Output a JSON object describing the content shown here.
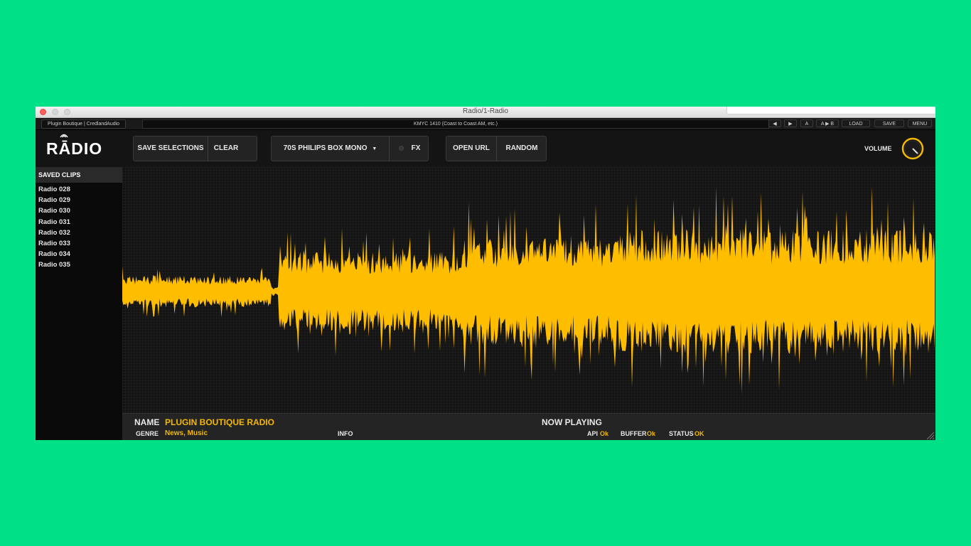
{
  "window": {
    "title": "Radio/1-Radio"
  },
  "host": {
    "tab_label": "Plugin Boutique | CredlandAudio",
    "preset_name": "KMYC 1410 (Coast to Coast AM, etc.)",
    "prev_icon": "◀",
    "next_icon": "▶",
    "a_label": "A",
    "a_to_b_label": "A ▶ B",
    "load_label": "LOAD",
    "save_label": "SAVE",
    "menu_label": "MENU"
  },
  "toolbar": {
    "logo": "RĀDIO",
    "save_selections_label": "SAVE SELECTIONS",
    "clear_label": "CLEAR",
    "preset_label": "70S PHILIPS BOX MONO",
    "preset_arrow": "▼",
    "fx_label": "FX",
    "open_url_label": "OPEN URL",
    "random_label": "RANDOM",
    "volume_label": "VOLUME"
  },
  "sidebar": {
    "heading": "SAVED CLIPS",
    "clips": [
      "Radio 028",
      "Radio 029",
      "Radio 030",
      "Radio 031",
      "Radio 032",
      "Radio 033",
      "Radio 034",
      "Radio 035"
    ]
  },
  "info": {
    "name_label": "NAME",
    "name_value": "PLUGIN BOUTIQUE RADIO",
    "genre_label": "GENRE",
    "genre_value": "News, Music",
    "info_label": "INFO",
    "now_playing_label": "NOW PLAYING",
    "api_label": "API",
    "api_value": "Ok",
    "buffer_label": "BUFFER",
    "buffer_value": "Ok",
    "status_label": "STATUS",
    "status_value": "OK"
  },
  "colors": {
    "background": "#00e187",
    "waveform": "#ffbd00",
    "accent_text": "#f5b800"
  },
  "icons": {
    "close": "close-icon",
    "minimize": "minimize-icon",
    "maximize": "maximize-icon",
    "volume_knob": "knob-icon",
    "dropdown": "chevron-down-icon",
    "resize": "resize-grip-icon"
  }
}
